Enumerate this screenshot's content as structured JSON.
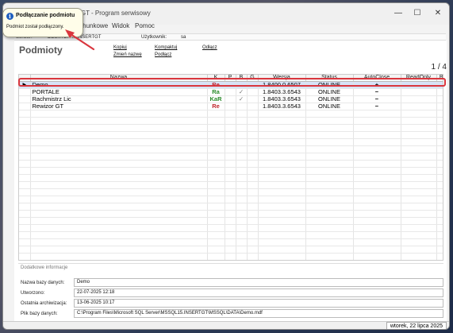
{
  "window": {
    "title": "...SERTGT - Program serwisowy",
    "minimize": "—",
    "maximize": "☐",
    "close": "✕"
  },
  "menu": {
    "items": [
      "...achunkowe",
      "Widok",
      "Pomoc"
    ]
  },
  "infobar": {
    "server_label": "Serwer:",
    "server_value": "DESKTOP-...\\INSERTGT",
    "user_label": "Użytkownik:",
    "user_value": "sa"
  },
  "page": {
    "title": "Podmioty",
    "actions": {
      "copy": "Kopiuj",
      "rename": "Zmień nazwę",
      "compact": "Kompaktuj",
      "attach": "Podłącz",
      "detach": "Odłącz"
    },
    "pager": "1 / 4"
  },
  "grid": {
    "columns": [
      "Nazwa",
      "K",
      "P",
      "B",
      "G",
      "Wersja",
      "Status",
      "AutoClose",
      "ReadOnly",
      "Biuro"
    ],
    "rows": [
      {
        "name": "Demo",
        "k": "Re",
        "k_color": "#c0262d",
        "p": "",
        "b": "",
        "g": "",
        "version": "1.8400.0.6507",
        "status": "ONLINE",
        "autoclose": "+",
        "readonly": "",
        "office": "",
        "selected": true
      },
      {
        "name": "PORTALE",
        "k": "Ra",
        "k_color": "#2a8a2a",
        "p": "",
        "b": "✓",
        "g": "",
        "version": "1.8403.3.6543",
        "status": "ONLINE",
        "autoclose": "−",
        "readonly": "",
        "office": "",
        "selected": false
      },
      {
        "name": "Rachmistrz Lic",
        "k": "KaR",
        "k_color": "#2a8a2a",
        "p": "",
        "b": "✓",
        "g": "",
        "version": "1.8403.3.6543",
        "status": "ONLINE",
        "autoclose": "−",
        "readonly": "",
        "office": "",
        "selected": false
      },
      {
        "name": "Rewizor GT",
        "k": "Re",
        "k_color": "#c0262d",
        "p": "",
        "b": "",
        "g": "",
        "version": "1.8403.3.6543",
        "status": "ONLINE",
        "autoclose": "−",
        "readonly": "",
        "office": "",
        "selected": false
      }
    ]
  },
  "details": {
    "section_title": "Dodatkowe informacje",
    "db_name_label": "Nazwa bazy danych:",
    "db_name_value": "Demo",
    "created_label": "Utworzono:",
    "created_value": "22-07-2025 12:18",
    "archived_label": "Ostatnia archiwizacja:",
    "archived_value": "13-06-2025 10:17",
    "file_label": "Plik bazy danych:",
    "file_value": "C:\\Program Files\\Microsoft SQL Server\\MSSQL15.INSERTGT\\MSSQL\\DATA\\Demo.mdf"
  },
  "status": {
    "date": "wtorek, 22 lipca 2025"
  },
  "toast": {
    "title": "Podłączanie podmiotu",
    "message": "Podmiot został podłączony."
  },
  "colors": {
    "selection_outline": "#d9363e",
    "selected_row": "#d7e3f7"
  }
}
